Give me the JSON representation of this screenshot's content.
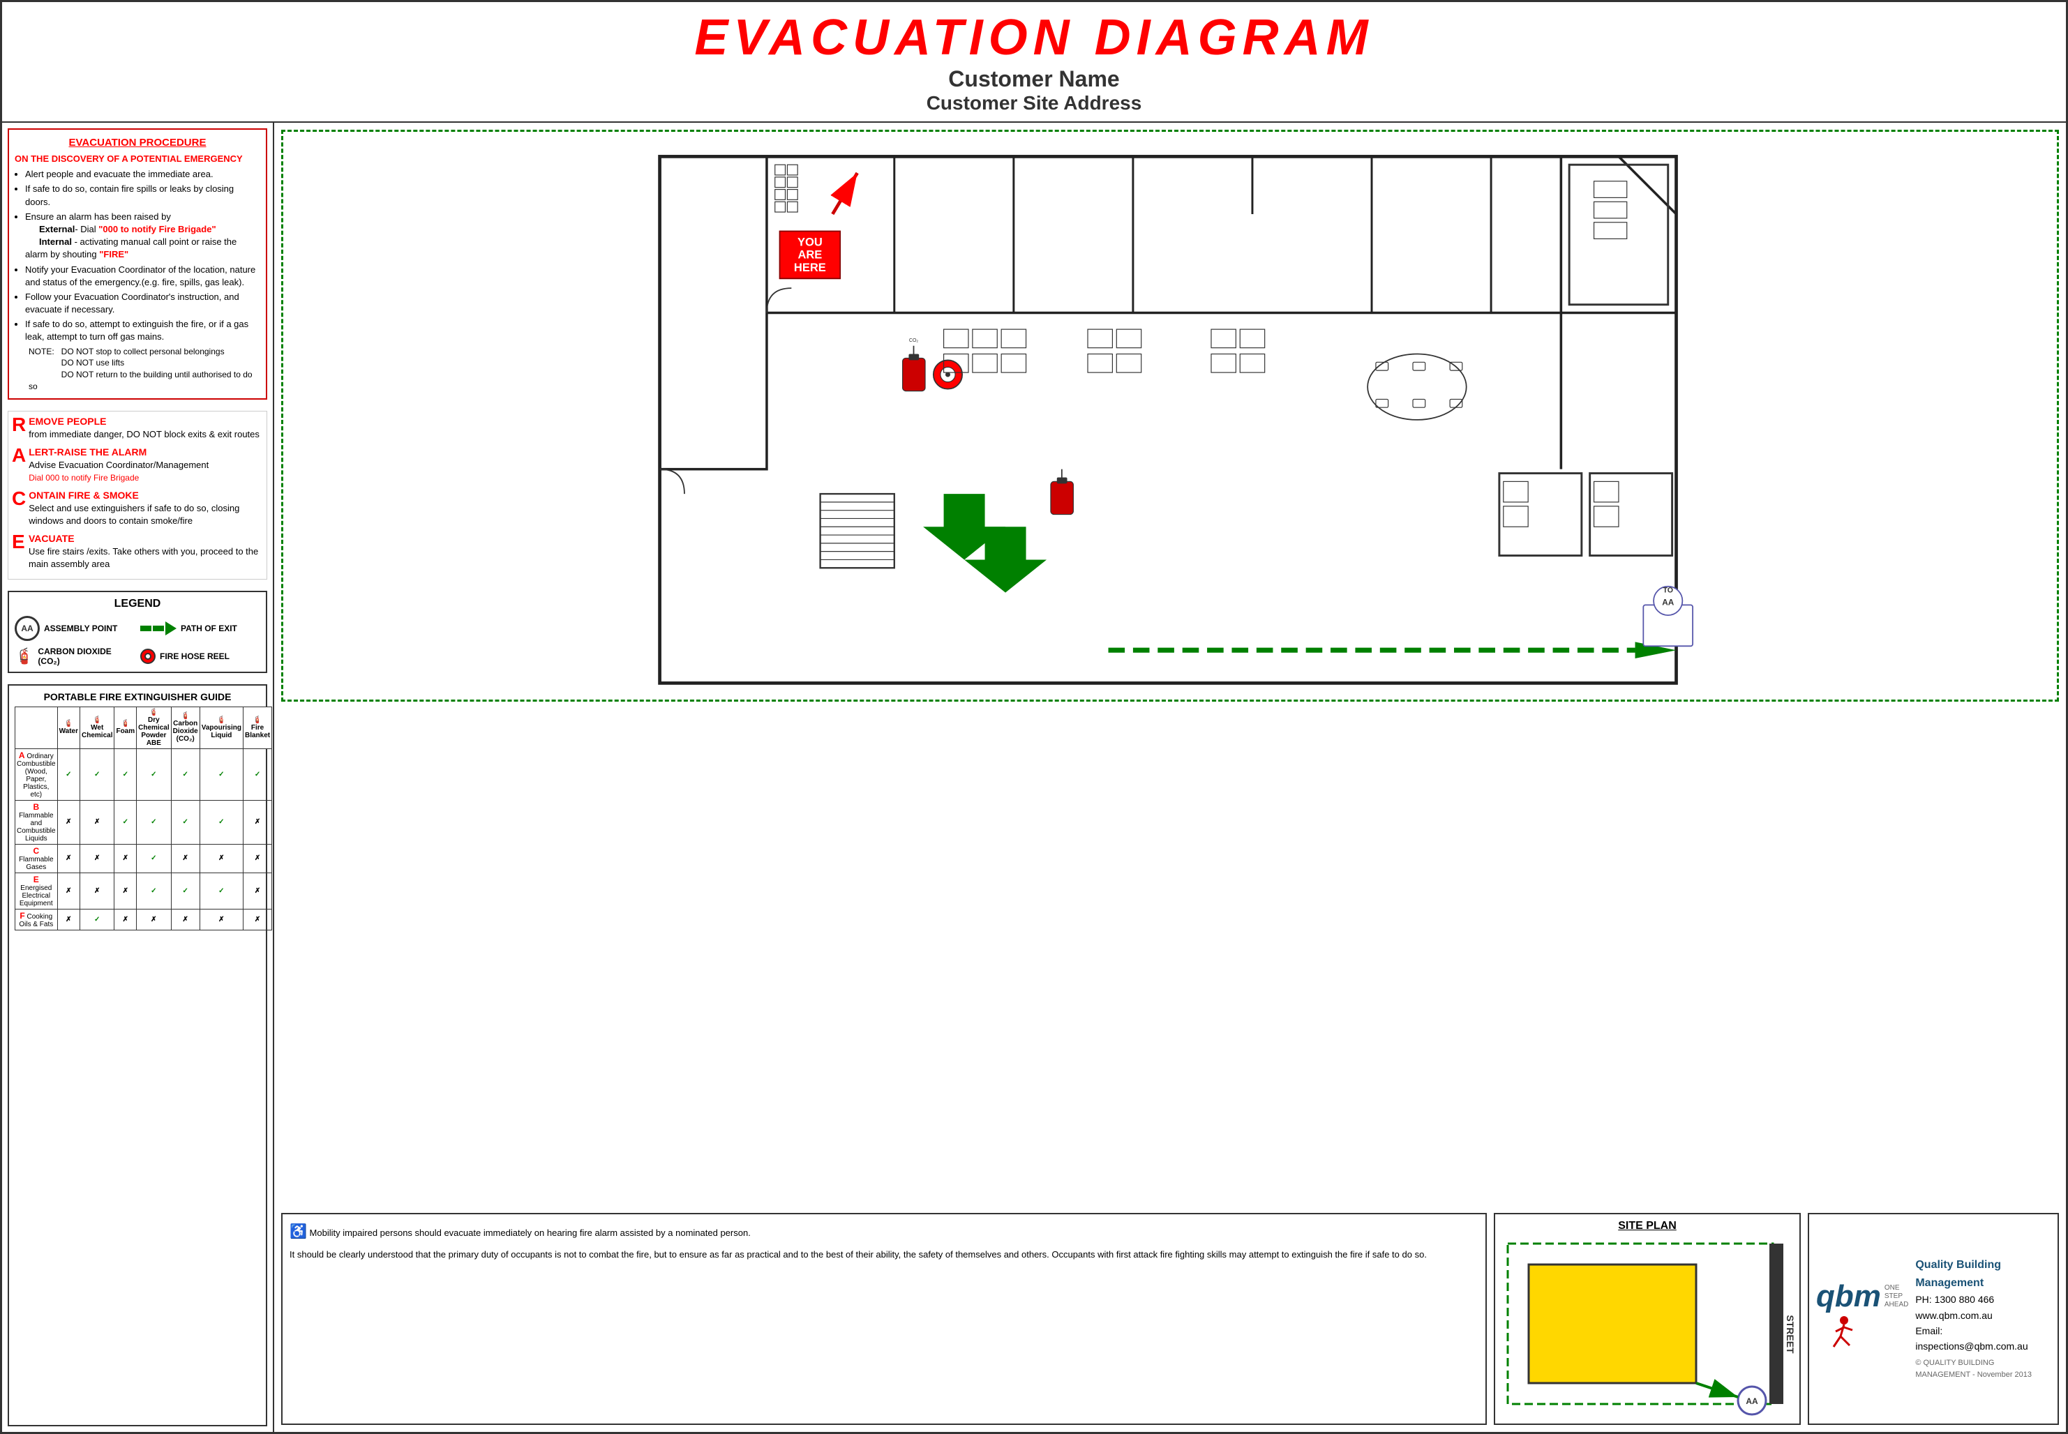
{
  "header": {
    "title": "EVACUATION  DIAGRAM",
    "customer_name": "Customer Name",
    "customer_address": "Customer Site Address"
  },
  "evac_procedure": {
    "title": "EVACUATION PROCEDURE",
    "subtitle": "ON THE DISCOVERY OF A POTENTIAL EMERGENCY",
    "points": [
      "Alert people and evacuate the immediate area.",
      "If safe to do so, contain fire spills or leaks by closing doors.",
      "Ensure an alarm has been raised by External- Dial \"000 to notify Fire Brigade\" Internal - activating manual call point or raise the alarm by shouting \"FIRE\"",
      "Notify your Evacuation Coordinator of the location, nature and status of the emergency.(e.g. fire, spills, gas leak).",
      "Follow your Evacuation Coordinator's instruction, and evacuate if necessary.",
      "If safe to do so, attempt to extinguish the fire, or if a gas leak, attempt to turn off gas mains.",
      "NOTE:  DO NOT stop to collect personal belongings DO NOT use lifts DO NOT return to the building until authorised to do so"
    ]
  },
  "race": {
    "r": {
      "letter": "R",
      "title": "EMOVE PEOPLE",
      "desc": "from immediate danger, DO NOT block exits & exit routes"
    },
    "a": {
      "letter": "A",
      "title": "LERT-RAISE THE ALARM",
      "desc": "Advise Evacuation Coordinator/Management",
      "dial": "Dial 000 to notify Fire Brigade"
    },
    "c": {
      "letter": "C",
      "title": "ONTAIN FIRE & SMOKE",
      "desc": "Select and use extinguishers if safe to do so, closing windows and doors to contain smoke/fire"
    },
    "e": {
      "letter": "E",
      "title": "VACUATE",
      "desc": "Use fire stairs /exits. Take others with you, proceed to the main assembly area"
    }
  },
  "legend": {
    "title": "LEGEND",
    "assembly_point": "ASSEMBLY POINT",
    "path_of_exit": "PATH OF EXIT",
    "carbon_dioxide": "CARBON DIOXIDE (CO₂)",
    "fire_hose_reel": "FIRE HOSE REEL"
  },
  "extinguisher_guide": {
    "title": "PORTABLE FIRE EXTINGUISHER GUIDE",
    "columns": [
      "Water",
      "Wet Chemical",
      "Foam",
      "Dry Chemical Powder ABE",
      "Carbon Dioxide (CO₂)",
      "Vapourising Liquid",
      "Fire Blanket"
    ],
    "rows": [
      {
        "label": "A",
        "type": "Ordinary Combustible (Wood, Paper, Plastics, etc)",
        "values": [
          "✓",
          "✓",
          "✓",
          "✓",
          "✓",
          "✓",
          "✓"
        ]
      },
      {
        "label": "B",
        "type": "Flammable and Combustible Liquids",
        "values": [
          "✗",
          "✗",
          "✓",
          "✓",
          "✓",
          "✓",
          "✗"
        ]
      },
      {
        "label": "C",
        "type": "Flammable Gases",
        "values": [
          "✗",
          "✗",
          "✗",
          "✓",
          "✗",
          "✗",
          "✗"
        ]
      },
      {
        "label": "E",
        "type": "Energised Electrical Equipment",
        "values": [
          "✗",
          "✗",
          "✗",
          "✓",
          "✓",
          "✓",
          "✗"
        ]
      },
      {
        "label": "F",
        "type": "Cooking Oils & Fats",
        "values": [
          "✗",
          "✓",
          "✗",
          "✗",
          "✗",
          "✗",
          "✗"
        ]
      }
    ]
  },
  "disclaimer": {
    "wheelchair_text": "Mobility impaired persons should evacuate immediately on hearing fire alarm assisted by a nominated person.",
    "main_text": "It should be clearly understood that the primary duty of occupants is not to combat the fire, but to ensure as far as practical and to the best of their ability, the safety of themselves and others. Occupants with first attack fire fighting skills may attempt to extinguish the fire if safe to do so."
  },
  "site_plan": {
    "title": "SITE PLAN",
    "street_label": "STREET"
  },
  "contact": {
    "company": "Quality Building Management",
    "phone": "PH: 1300 880 466",
    "website": "www.qbm.com.au",
    "email": "Email: inspections@qbm.com.au",
    "copyright": "© QUALITY BUILDING MANAGEMENT - November 2013"
  },
  "you_are_here": {
    "line1": "YOU",
    "line2": "ARE",
    "line3": "HERE"
  },
  "assembly": {
    "label": "AA",
    "to_label": "TO",
    "aa_label": "AA"
  }
}
